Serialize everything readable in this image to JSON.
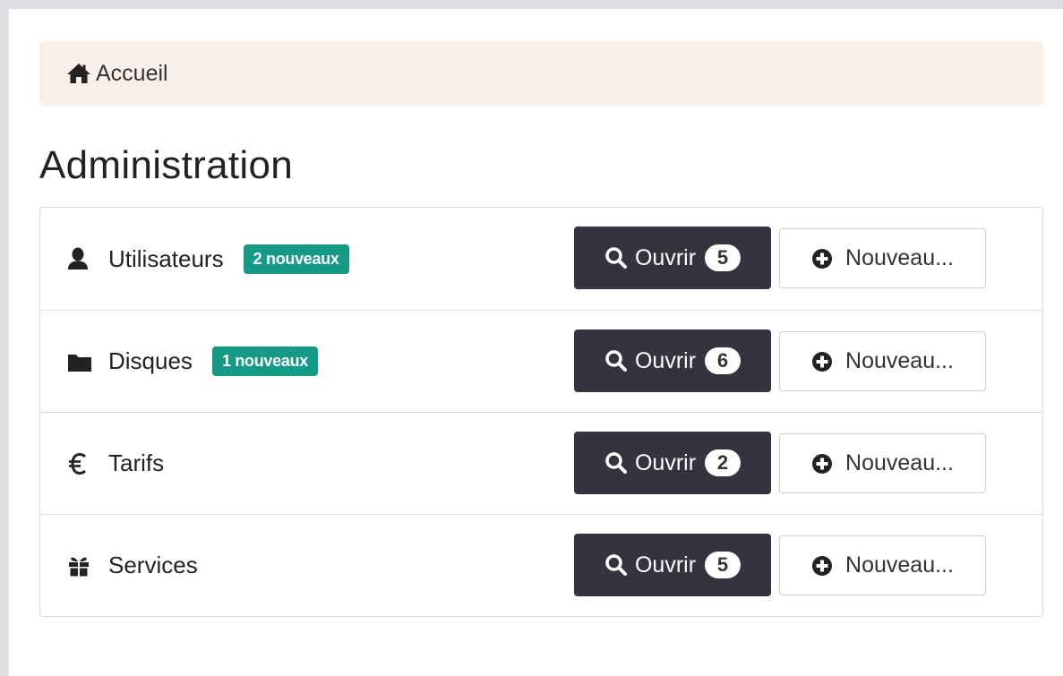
{
  "breadcrumb": {
    "home_label": "Accueil"
  },
  "page": {
    "title": "Administration"
  },
  "rows": [
    {
      "icon": "user-icon",
      "label": "Utilisateurs",
      "badge": "2 nouveaux",
      "open_label": "Ouvrir",
      "count": "5",
      "new_label": "Nouveau..."
    },
    {
      "icon": "folder-icon",
      "label": "Disques",
      "badge": "1 nouveaux",
      "open_label": "Ouvrir",
      "count": "6",
      "new_label": "Nouveau..."
    },
    {
      "icon": "euro-icon",
      "label": "Tarifs",
      "badge": "",
      "open_label": "Ouvrir",
      "count": "2",
      "new_label": "Nouveau..."
    },
    {
      "icon": "gift-icon",
      "label": "Services",
      "badge": "",
      "open_label": "Ouvrir",
      "count": "5",
      "new_label": "Nouveau..."
    }
  ],
  "colors": {
    "badge": "#159a86",
    "open_button": "#34343f",
    "breadcrumb_bg": "#f8efe9"
  }
}
